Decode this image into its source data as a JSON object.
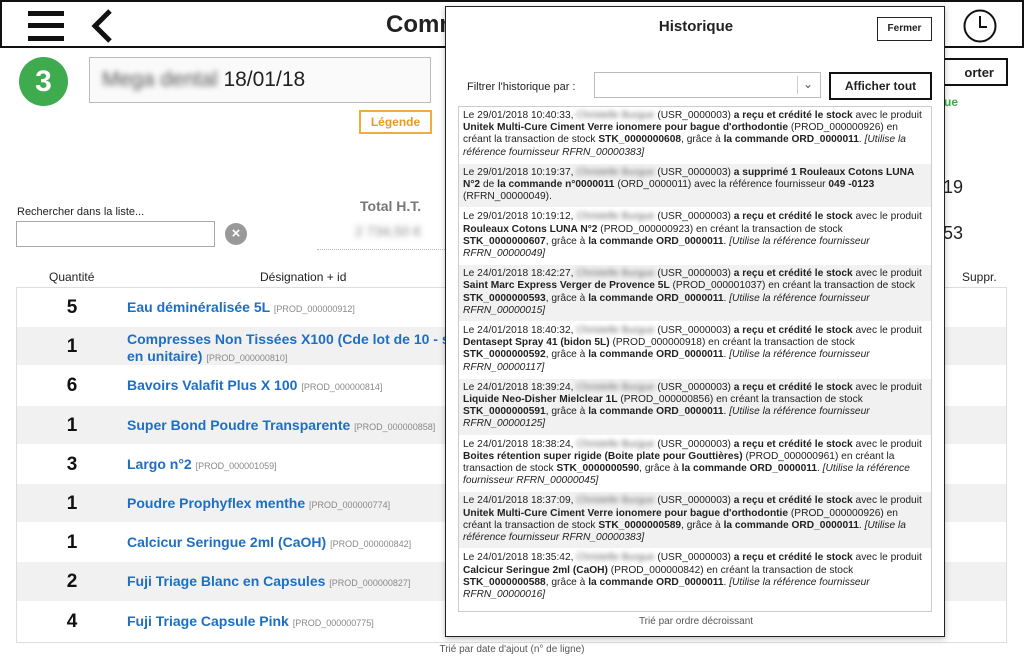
{
  "header": {
    "title": "Comm",
    "menu_icon": "hamburger-icon",
    "back_icon": "chevron-left-icon",
    "history_icon": "clock-icon"
  },
  "order": {
    "step": "3",
    "supplier": "Mega dental",
    "date": "18/01/18",
    "legend_label": "Légende",
    "export_label": "orter",
    "status_text": "ue"
  },
  "search": {
    "label": "Rechercher dans la liste...",
    "value": "",
    "clear_icon": "clear-icon"
  },
  "totals": {
    "label": "Total H.T.",
    "value": "2 734,50 €",
    "right_value_1": "19",
    "right_value_2": "53"
  },
  "table": {
    "columns": {
      "qty": "Quantité",
      "designation": "Désignation + id",
      "delete": "Suppr."
    },
    "rows": [
      {
        "qty": "5",
        "name": "Eau déminéralisée 5L",
        "id": "[PROD_000000912]"
      },
      {
        "qty": "1",
        "name": "Compresses Non Tissées X100 (Cde lot de 10 - s",
        "name2": "en unitaire)",
        "id": "[PROD_000000810]"
      },
      {
        "qty": "6",
        "name": "Bavoirs Valafit Plus X 100",
        "id": "[PROD_000000814]"
      },
      {
        "qty": "1",
        "name": "Super Bond Poudre Transparente",
        "id": "[PROD_000000858]"
      },
      {
        "qty": "3",
        "name": "Largo n°2",
        "id": "[PROD_000001059]"
      },
      {
        "qty": "1",
        "name": "Poudre Prophyflex menthe",
        "id": "[PROD_000000774]"
      },
      {
        "qty": "1",
        "name": "Calcicur Seringue 2ml (CaOH)",
        "id": "[PROD_000000842]"
      },
      {
        "qty": "2",
        "name": "Fuji Triage Blanc en Capsules",
        "id": "[PROD_000000827]"
      },
      {
        "qty": "4",
        "name": "Fuji Triage Capsule Pink",
        "id": "[PROD_000000775]"
      }
    ],
    "footer": "Trié par date d'ajout (n° de ligne)"
  },
  "history": {
    "title": "Historique",
    "close_label": "Fermer",
    "filter_label": "Filtrer l'historique par :",
    "filter_value": "",
    "show_all_label": "Afficher tout",
    "sort_note": "Trié par ordre décroissant",
    "user_name": "Christelle Burgue",
    "entries": [
      {
        "date": "Le 29/01/2018 10:40:33,",
        "user_id": "(USR_0000003)",
        "action": "a reçu et crédité le stock",
        "text1": "avec le produit",
        "product": "Unitek Multi-Cure Ciment Verre ionomere pour bague d'orthodontie",
        "prod_id": "(PROD_000000926) en créant la transaction de stock",
        "stk": "STK_0000000608",
        "text2": ", grâce à",
        "order": "la commande ORD_0000011",
        "ref": "[Utilise la référence fournisseur RFRN_00000383]"
      },
      {
        "kind": "delete",
        "date": "Le 29/01/2018 10:19:37,",
        "user_id": "(USR_0000003)",
        "action": "a supprimé 1 Rouleaux Cotons LUNA N°2",
        "text1": "de",
        "order": "la commande n°0000011",
        "text2": "(ORD_0000011) avec la référence fournisseur",
        "ref_bold": "049 -0123",
        "ref_end": "(RFRN_00000049)."
      },
      {
        "date": "Le 29/01/2018 10:19:12,",
        "user_id": "(USR_0000003)",
        "action": "a reçu et crédité le stock",
        "text1": "avec le produit",
        "product": "Rouleaux Cotons LUNA N°2",
        "prod_id": "(PROD_000000923) en créant la transaction de stock",
        "stk": "STK_0000000607",
        "text2": ", grâce à",
        "order": "la commande ORD_0000011",
        "ref": "[Utilise la référence fournisseur RFRN_00000049]"
      },
      {
        "date": "Le 24/01/2018 18:42:27,",
        "user_id": "(USR_0000003)",
        "action": "a reçu et crédité le stock",
        "text1": "avec le produit",
        "product": "Saint Marc Express Verger de Provence 5L",
        "prod_id": "(PROD_000001037) en créant la transaction de stock",
        "stk": "STK_0000000593",
        "text2": ", grâce à",
        "order": "la commande ORD_0000011",
        "ref": "[Utilise la référence fournisseur RFRN_00000015]"
      },
      {
        "date": "Le 24/01/2018 18:40:32,",
        "user_id": "(USR_0000003)",
        "action": "a reçu et crédité le stock",
        "text1": "avec le produit",
        "product": "Dentasept Spray 41 (bidon 5L)",
        "prod_id": "(PROD_000000918) en créant la transaction de stock",
        "stk": "STK_0000000592",
        "text2": ", grâce à",
        "order": "la commande ORD_0000011",
        "ref": "[Utilise la référence fournisseur RFRN_00000117]"
      },
      {
        "date": "Le 24/01/2018 18:39:24,",
        "user_id": "(USR_0000003)",
        "action": "a reçu et crédité le stock",
        "text1": "avec le produit",
        "product": "Liquide Neo-Disher  Mielclear 1L",
        "prod_id": "(PROD_000000856) en créant la transaction de stock",
        "stk": "STK_0000000591",
        "text2": ", grâce à",
        "order": "la commande ORD_0000011",
        "ref": "[Utilise la référence fournisseur RFRN_00000125]"
      },
      {
        "date": "Le 24/01/2018 18:38:24,",
        "user_id": "(USR_0000003)",
        "action": "a reçu et crédité le stock",
        "text1": "avec le produit",
        "product": "Boites rétention super rigide (Boite plate pour Gouttières)",
        "prod_id": "(PROD_000000961) en créant la transaction de stock",
        "stk": "STK_0000000590",
        "text2": ", grâce à",
        "order": "la commande ORD_0000011",
        "ref": "[Utilise la référence fournisseur RFRN_00000045]"
      },
      {
        "date": "Le 24/01/2018 18:37:09,",
        "user_id": "(USR_0000003)",
        "action": "a reçu et crédité le stock",
        "text1": "avec le produit",
        "product": "Unitek Multi-Cure Ciment Verre ionomere pour bague d'orthodontie",
        "prod_id": "(PROD_000000926) en créant la transaction de stock",
        "stk": "STK_0000000589",
        "text2": ", grâce à",
        "order": "la commande ORD_0000011",
        "ref": "[Utilise la référence fournisseur RFRN_00000383]"
      },
      {
        "date": "Le 24/01/2018 18:35:42,",
        "user_id": "(USR_0000003)",
        "action": "a reçu et crédité le stock",
        "text1": "avec le produit",
        "product": "Calcicur Seringue 2ml (CaOH)",
        "prod_id": "(PROD_000000842) en créant la transaction de stock",
        "stk": "STK_0000000588",
        "text2": ", grâce à",
        "order": "la commande ORD_0000011",
        "ref": "[Utilise la référence fournisseur RFRN_00000016]"
      }
    ]
  }
}
